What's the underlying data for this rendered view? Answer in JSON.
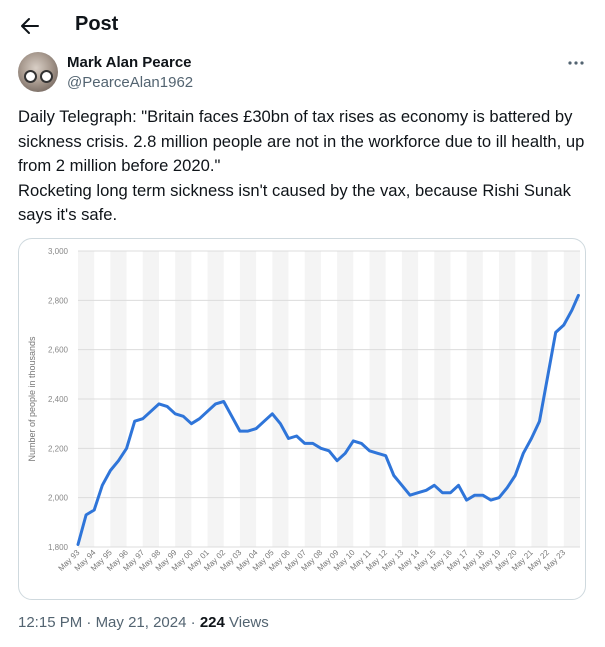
{
  "header": {
    "title": "Post"
  },
  "author": {
    "name": "Mark Alan Pearce",
    "handle": "@PearceAlan1962"
  },
  "tweet": {
    "line1": "Daily Telegraph: \"Britain faces £30bn of tax rises as economy is battered by sickness crisis. 2.8 million people are not in the workforce due to ill health, up from 2 million before 2020.\"",
    "line2": "Rocketing long term sickness isn't caused by the vax, because Rishi Sunak says it's safe."
  },
  "footer": {
    "time": "12:15 PM",
    "date": "May 21, 2024",
    "views": "224",
    "views_label": "Views"
  },
  "chart_data": {
    "type": "line",
    "title": "",
    "xlabel": "",
    "ylabel": "Number of people in thousands",
    "ylim": [
      1800,
      3000
    ],
    "yticks": [
      "1,800",
      "2,000",
      "2,200",
      "2,400",
      "2,600",
      "2,800",
      "3,000"
    ],
    "categories": [
      "May 93",
      "May 94",
      "May 95",
      "May 96",
      "May 97",
      "May 98",
      "May 99",
      "May 00",
      "May 01",
      "May 02",
      "May 03",
      "May 04",
      "May 05",
      "May 06",
      "May 07",
      "May 08",
      "May 09",
      "May 10",
      "May 11",
      "May 12",
      "May 13",
      "May 14",
      "May 15",
      "May 16",
      "May 17",
      "May 18",
      "May 19",
      "May 20",
      "May 21",
      "May 22",
      "May 23"
    ],
    "grid": true,
    "legend": "none",
    "color": "#2f75d9",
    "series": [
      {
        "x": [
          1993.0,
          1993.5,
          1994.0,
          1994.5,
          1995.0,
          1995.5,
          1996.0,
          1996.5,
          1997.0,
          1997.5,
          1998.0,
          1998.5,
          1999.0,
          1999.5,
          2000.0,
          2000.5,
          2001.0,
          2001.5,
          2002.0,
          2002.5,
          2003.0,
          2003.5,
          2004.0,
          2004.5,
          2005.0,
          2005.5,
          2006.0,
          2006.5,
          2007.0,
          2007.5,
          2008.0,
          2008.5,
          2009.0,
          2009.5,
          2010.0,
          2010.5,
          2011.0,
          2011.5,
          2012.0,
          2012.5,
          2013.0,
          2013.5,
          2014.0,
          2014.5,
          2015.0,
          2015.5,
          2016.0,
          2016.5,
          2017.0,
          2017.5,
          2018.0,
          2018.5,
          2019.0,
          2019.5,
          2020.0,
          2020.5,
          2021.0,
          2021.5,
          2022.0,
          2022.5,
          2023.0,
          2023.5,
          2023.9
        ],
        "y": [
          1810,
          1930,
          1950,
          2050,
          2110,
          2150,
          2200,
          2310,
          2320,
          2350,
          2380,
          2370,
          2340,
          2330,
          2300,
          2320,
          2350,
          2380,
          2390,
          2330,
          2270,
          2270,
          2280,
          2310,
          2340,
          2300,
          2240,
          2250,
          2220,
          2220,
          2200,
          2190,
          2150,
          2180,
          2230,
          2220,
          2190,
          2180,
          2170,
          2090,
          2050,
          2010,
          2020,
          2030,
          2050,
          2020,
          2020,
          2050,
          1990,
          2010,
          2010,
          1990,
          2000,
          2040,
          2090,
          2180,
          2240,
          2310,
          2490,
          2670,
          2700,
          2760,
          2820
        ]
      }
    ]
  }
}
